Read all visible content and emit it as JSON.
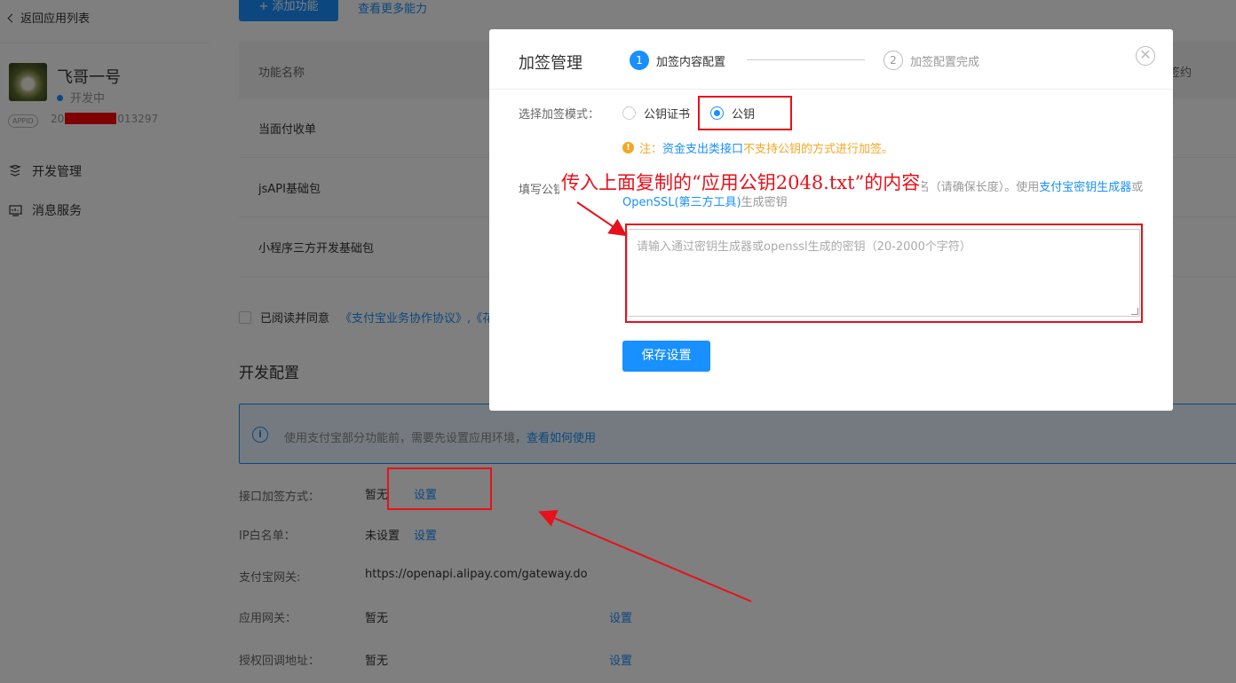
{
  "sidebar": {
    "back_label": "返回应用列表",
    "app_name": "飞哥一号",
    "app_status": "开发中",
    "appid_badge": "APPID",
    "appid_prefix": "20",
    "appid_suffix": "013297",
    "nav": [
      {
        "label": "开发管理",
        "icon": "tree-icon"
      },
      {
        "label": "消息服务",
        "icon": "monitor-icon"
      }
    ]
  },
  "main": {
    "add_button": "+ 添加功能",
    "more_link": "查看更多能力",
    "table": {
      "header_name": "功能名称",
      "header_right": "签约",
      "rows": [
        "当面付收单",
        "jsAPI基础包",
        "小程序三方开发基础包"
      ]
    },
    "agree_text": "已阅读并同意",
    "agree_link": "《支付宝业务协作协议》,《花",
    "dev_config_title": "开发配置",
    "info_text": "使用支付宝部分功能前，需要先设置应用环境，",
    "info_link": "查看如何使用",
    "config": [
      {
        "label": "接口加签方式：",
        "value": "暂无",
        "action": "设置"
      },
      {
        "label": "IP白名单：",
        "value": "未设置",
        "action": "设置"
      },
      {
        "label": "支付宝网关:",
        "value": "https://openapi.alipay.com/gateway.do",
        "action": ""
      },
      {
        "label": "应用网关：",
        "value": "暂无",
        "action": "设置"
      },
      {
        "label": "授权回调地址：",
        "value": "暂无",
        "action": "设置"
      }
    ]
  },
  "modal": {
    "title": "加签管理",
    "steps": [
      {
        "num": "1",
        "label": "加签内容配置",
        "state": "active"
      },
      {
        "num": "2",
        "label": "加签配置完成",
        "state": "todo"
      }
    ],
    "close_glyph": "✕",
    "mode_label": "选择加签模式：",
    "mode_options": [
      "公钥证书",
      "公钥"
    ],
    "mode_selected": "公钥",
    "warn_prefix": "注：",
    "warn_link": "资金支出类接口",
    "warn_suffix": "不支持公钥的方式进行加签。",
    "fill_label": "填写公钥字符",
    "fill_desc_mid": "：SHA256withRsa对应支付宝应用公钥字符，即RSA2签名（请确保长度）。使用",
    "fill_link1": "支付宝密钥生成器",
    "fill_or": "或",
    "fill_link2": "OpenSSL(第三方工具)",
    "fill_desc_end": "生成密钥",
    "input_placeholder": "请输入通过密钥生成器或openssl生成的密钥（20-2000个字符）",
    "input_value": "",
    "save_button": "保存设置"
  },
  "annotation": {
    "text": "传入上面复制的“应用公钥2048.txt”的内容",
    "color": "#e8101a"
  },
  "colors": {
    "accent": "#1890ff",
    "warning": "#f5a623",
    "annotation": "#e8101a"
  }
}
